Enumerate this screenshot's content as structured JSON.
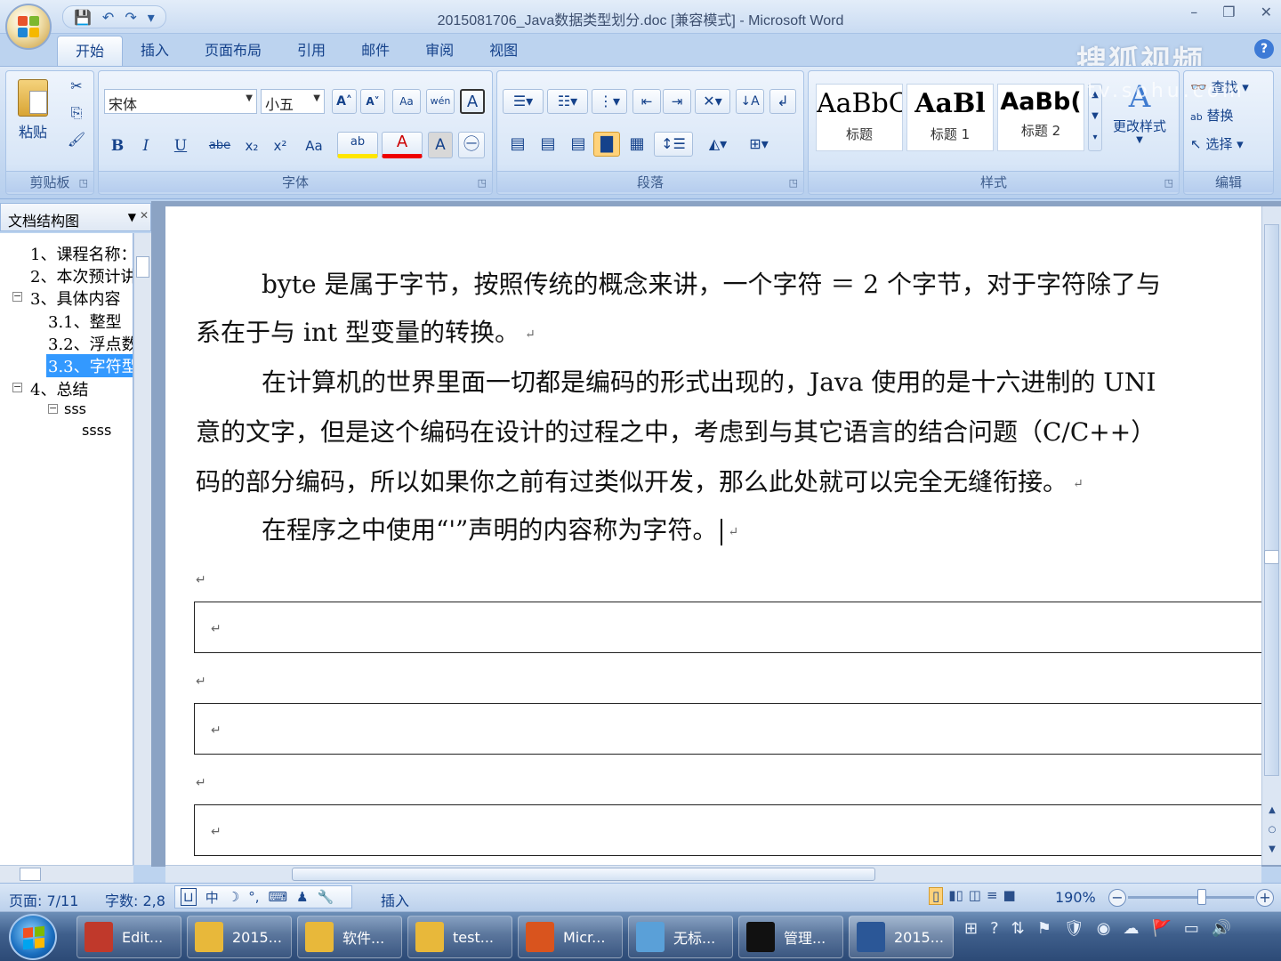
{
  "window": {
    "title": "2015081706_Java数据类型划分.doc [兼容模式] - Microsoft Word",
    "controls": {
      "minimize": "–",
      "restore": "❐",
      "close": "✕"
    }
  },
  "quick_access": {
    "save": "💾",
    "undo": "↶",
    "redo": "↷",
    "customize": "▾"
  },
  "ribbon": {
    "tabs": [
      "开始",
      "插入",
      "页面布局",
      "引用",
      "邮件",
      "审阅",
      "视图"
    ],
    "active_tab": "开始",
    "help": "?",
    "watermark": "搜狐视频",
    "watermark_url": "tv.sohu.com",
    "clipboard": {
      "label": "剪贴板",
      "paste": "粘贴",
      "cut": "✂",
      "copy": "⎘",
      "format_painter": "🖌"
    },
    "font": {
      "label": "字体",
      "font_name": "宋体",
      "font_size": "小五",
      "grow": "A˄",
      "shrink": "A˅",
      "clear": "Aa",
      "phonetic": "wén",
      "border": "A",
      "bold": "B",
      "italic": "I",
      "underline": "U",
      "strike": "abe",
      "subscript": "x₂",
      "superscript": "x²",
      "case": "Aa",
      "highlight": "ab",
      "font_color": "A",
      "shading": "A",
      "enclose": "㊀"
    },
    "paragraph": {
      "label": "段落"
    },
    "styles": {
      "label": "样式",
      "items": [
        {
          "sample": "AaBbC",
          "name": "标题"
        },
        {
          "sample": "AaBl",
          "name": "标题 1"
        },
        {
          "sample": "AaBb(",
          "name": "标题 2"
        }
      ],
      "change_styles": "更改样式"
    },
    "editing": {
      "label": "编辑",
      "find": "查找",
      "replace": "替换",
      "select": "选择"
    }
  },
  "doc_map": {
    "title": "文档结构图",
    "items": [
      {
        "text": "1、课程名称：",
        "level": 1
      },
      {
        "text": "2、本次预计讲",
        "level": 1
      },
      {
        "text": "3、具体内容",
        "level": 1,
        "toggle": "⊟"
      },
      {
        "text": "3.1、整型",
        "level": 2
      },
      {
        "text": "3.2、浮点数",
        "level": 2
      },
      {
        "text": "3.3、字符型",
        "level": 2,
        "selected": true
      },
      {
        "text": "4、总结",
        "level": 1,
        "toggle": "⊟"
      },
      {
        "text": "sss",
        "level": 2,
        "toggle": "⊟"
      },
      {
        "text": "ssss",
        "level": 3
      }
    ]
  },
  "document": {
    "paragraphs": [
      "byte 是属于字节，按照传统的概念来讲，一个字符 ＝ 2 个字节，对于字符除了与",
      "系在于与 int 型变量的转换。",
      "在计算机的世界里面一切都是编码的形式出现的，Java 使用的是十六进制的 UNI",
      "意的文字，但是这个编码在设计的过程之中，考虑到与其它语言的结合问题（C/C++）",
      "码的部分编码，所以如果你之前有过类似开发，那么此处就可以完全无缝衔接。",
      "在程序之中使用“'”声明的内容称为字符。"
    ],
    "paragraph_mark": "↵"
  },
  "status_bar": {
    "page": "页面: 7/11",
    "words": "字数: 2,8",
    "ime": {
      "icon": "中",
      "moon": "☽",
      "punct": "°,",
      "keyboard": "⌨",
      "user": "♟",
      "tool": "🔧"
    },
    "insert_mode": "插入",
    "zoom": "190%",
    "zoom_out": "−",
    "zoom_in": "+"
  },
  "taskbar": {
    "items": [
      {
        "label": "Edit...",
        "color": "#c0392b"
      },
      {
        "label": "2015...",
        "color": "#e8b83a"
      },
      {
        "label": "软件...",
        "color": "#e8b83a"
      },
      {
        "label": "test...",
        "color": "#e8b83a"
      },
      {
        "label": "Micr...",
        "color": "#d9541e"
      },
      {
        "label": "无标...",
        "color": "#5aa0d8"
      },
      {
        "label": "管理...",
        "color": "#111111"
      },
      {
        "label": "2015...",
        "color": "#2b5797"
      }
    ],
    "tray": [
      "⊞",
      "?",
      "⇅",
      "⚑",
      "🛡",
      "◉",
      "☁",
      "🚩",
      "▭",
      "🔊"
    ]
  }
}
